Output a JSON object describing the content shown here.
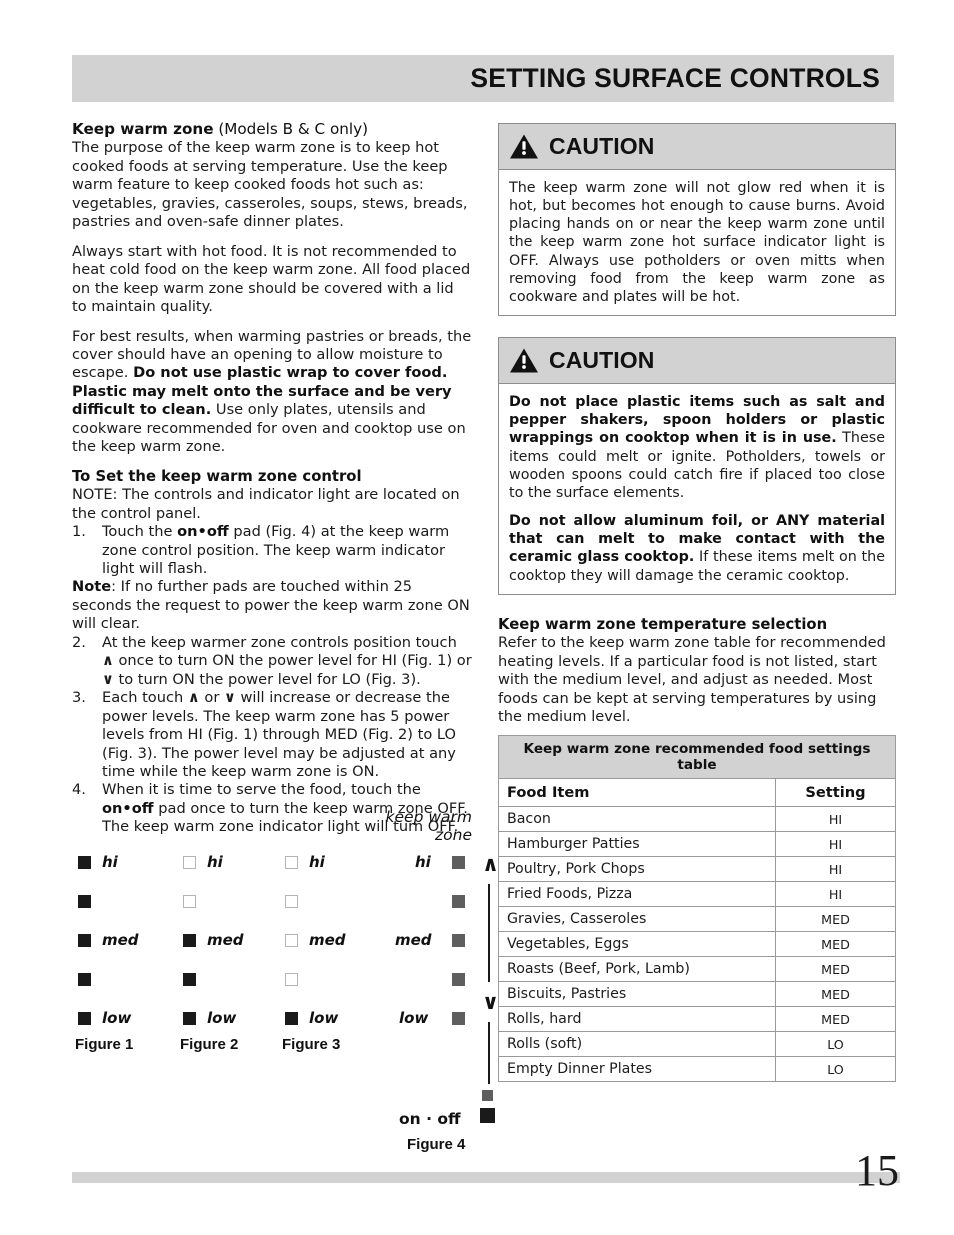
{
  "header": {
    "title": "SETTING SURFACE CONTROLS"
  },
  "left_column": {
    "section_title_bold": "Keep warm zone",
    "section_title_normal": " (Models B & C only)",
    "para1": "The purpose of the keep warm zone is to keep hot cooked foods at serving temperature. Use the keep warm feature to keep cooked foods hot such as: vegetables, gravies, casseroles, soups, stews, breads, pastries and oven-safe dinner plates.",
    "para2": "Always start with hot food. It is not recommended to heat cold food on the keep warm zone. All food placed on the keep warm zone should be covered with a lid to maintain quality.",
    "para3_a": "For best results, when warming pastries or breads, the cover should have an opening to allow moisture to escape. ",
    "para3_bold": "Do not use plastic wrap to cover food. Plastic may melt onto the surface and be very difficult to clean.",
    "para3_b": " Use only plates, utensils and cookware recommended for oven and cooktop use on the keep warm zone.",
    "sub_head": "To Set the keep warm zone control",
    "note_line": "NOTE: The controls and indicator light are located on the control panel.",
    "step1_num": "1.",
    "step1_a": "Touch the ",
    "step1_bold": "on•off",
    "step1_b": " pad (Fig. 4) at the keep warm zone control position. The keep warm indicator light will flash.",
    "note2_bold": "Note",
    "note2_rest": ": If no further pads are touched within 25 seconds the request to power the keep warm zone ON will clear.",
    "step2_num": "2.",
    "step2_a": "At the keep warmer zone controls position touch ",
    "step2_up": "∧",
    "step2_b": " once to turn ON the power level for HI (Fig. 1) or ",
    "step2_down": "∨",
    "step2_c": " to turn ON the power level for LO (Fig. 3).",
    "step3_num": "3.",
    "step3_a": "Each touch ",
    "step3_up": "∧",
    "step3_b": " or ",
    "step3_down": "∨",
    "step3_c": " will increase or decrease the power levels. The keep warm zone has 5 power levels from HI (Fig. 1) through MED (Fig. 2) to LO (Fig. 3). The power level may be adjusted at any time while the keep warm zone is ON.",
    "step4_num": "4.",
    "step4_a": "When it is time to serve the food, touch the ",
    "step4_bold": "on•off",
    "step4_b": " pad once to turn the keep warm zone OFF. The keep warm zone indicator light will turn OFF."
  },
  "caution_1": {
    "icon": "warning-triangle-icon",
    "label": "CAUTION",
    "body": "The keep warm zone will not glow red when it is hot, but becomes hot enough to cause burns. Avoid placing hands on or near the keep warm zone until the keep warm zone hot surface indicator light is OFF. Always use potholders or oven mitts when removing food from the keep warm zone as cookware and plates will be hot."
  },
  "caution_2": {
    "icon": "warning-triangle-icon",
    "label": "CAUTION",
    "p1_bold": "Do not place plastic items such as salt and pepper shakers, spoon holders or plastic wrappings on cooktop when it is in use.",
    "p1_rest": " These items could melt or ignite. Potholders, towels or wooden spoons could catch fire if placed too close to the surface elements.",
    "p2_bold": "Do not allow aluminum foil, or ANY material that can melt to make contact with the ceramic glass cooktop.",
    "p2_rest": " If these items melt on the cooktop they will damage the ceramic cooktop."
  },
  "right_column": {
    "temp_head": "Keep warm zone temperature selection",
    "temp_body": "Refer to the keep warm zone table for recommended heating levels. If a particular food is not listed, start with the medium level, and adjust as needed. Most foods can be kept at serving temperatures by using the medium level."
  },
  "table": {
    "title": "Keep warm zone recommended food settings table",
    "columns": [
      "Food Item",
      "Setting"
    ],
    "rows": [
      {
        "item": "Bacon",
        "setting": "HI"
      },
      {
        "item": "Hamburger Patties",
        "setting": "HI"
      },
      {
        "item": "Poultry, Pork Chops",
        "setting": "HI"
      },
      {
        "item": "Fried Foods, Pizza",
        "setting": "HI"
      },
      {
        "item": "Gravies, Casseroles",
        "setting": "MED"
      },
      {
        "item": "Vegetables, Eggs",
        "setting": "MED"
      },
      {
        "item": "Roasts (Beef, Pork, Lamb)",
        "setting": "MED"
      },
      {
        "item": "Biscuits, Pastries",
        "setting": "MED"
      },
      {
        "item": "Rolls, hard",
        "setting": "MED"
      },
      {
        "item": "Rolls (soft)",
        "setting": "LO"
      },
      {
        "item": "Empty Dinner Plates",
        "setting": "LO"
      }
    ]
  },
  "figures": {
    "level_labels": {
      "hi": "hi",
      "med": "med",
      "low": "low"
    },
    "fig1": {
      "caption": "Figure 1",
      "states": [
        "filled",
        "filled",
        "filled",
        "filled",
        "filled"
      ]
    },
    "fig2": {
      "caption": "Figure 2",
      "states": [
        "empty",
        "empty",
        "filled",
        "filled",
        "filled"
      ]
    },
    "fig3": {
      "caption": "Figure 3",
      "states": [
        "empty",
        "empty",
        "empty",
        "empty",
        "filled"
      ]
    },
    "fig4": {
      "caption": "Figure 4",
      "zone_label_line1": "keep warm",
      "zone_label_line2": "zone",
      "up_arrow": "∧",
      "down_arrow": "∨",
      "onoff_label": "on · off",
      "states": [
        "gray",
        "gray",
        "gray",
        "gray",
        "gray"
      ]
    }
  },
  "footer": {
    "page_number": "15"
  },
  "colors": {
    "band_gray": "#d2d2d2",
    "square_filled": "#1a1a1a",
    "square_gray": "#5e5e5e",
    "border": "#9a9a9a"
  }
}
